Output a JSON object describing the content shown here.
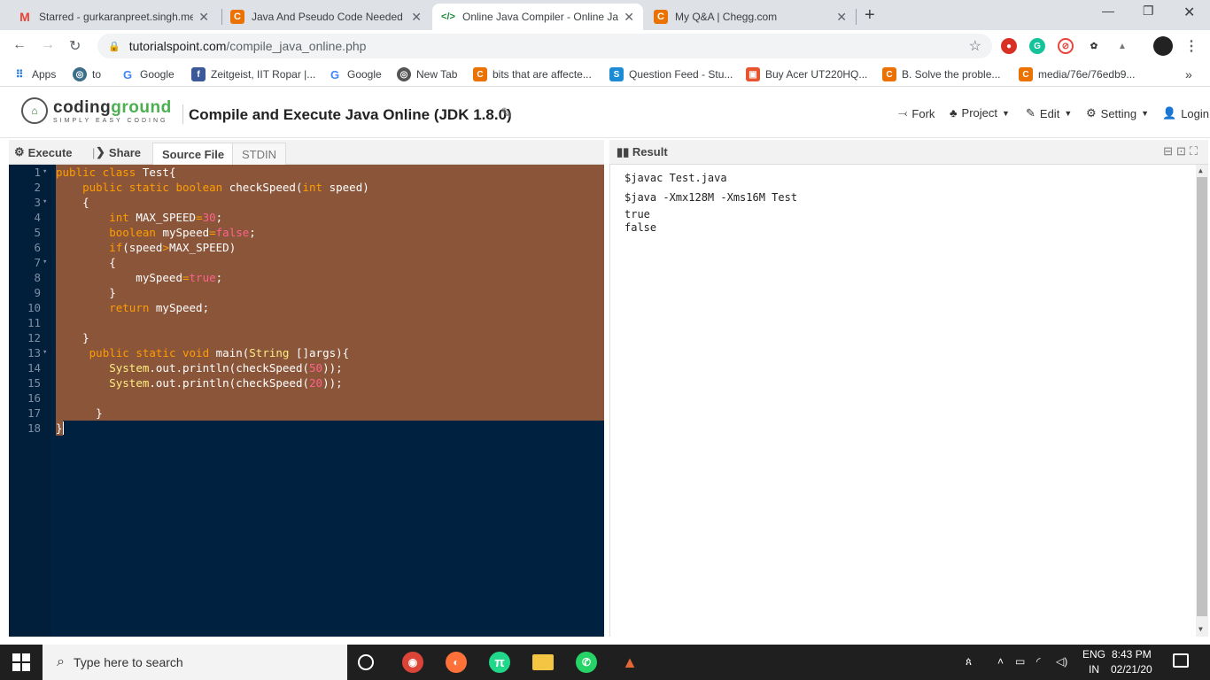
{
  "browser": {
    "tabs": [
      {
        "title": "Starred - gurkaranpreet.singh.me",
        "favicon": "gmail-icon",
        "color": "#ea4335",
        "glyph": "M"
      },
      {
        "title": "Java And Pseudo Code Needed M",
        "favicon": "chegg-icon",
        "color": "#eb7100",
        "glyph": "C"
      },
      {
        "title": "Online Java Compiler - Online Ja",
        "favicon": "code-icon",
        "color": "#1a73e8",
        "glyph": "</>"
      },
      {
        "title": "My Q&A | Chegg.com",
        "favicon": "chegg-icon",
        "color": "#eb7100",
        "glyph": "C"
      }
    ],
    "active_tab": 2,
    "url_domain": "tutorialspoint.com",
    "url_path": "/compile_java_online.php",
    "bookmarks": [
      {
        "label": "Apps",
        "icon": "apps-grid-icon"
      },
      {
        "label": "to",
        "icon": "globe-icon"
      },
      {
        "label": "Google",
        "icon": "google-icon"
      },
      {
        "label": "Zeitgeist, IIT Ropar |...",
        "icon": "facebook-icon"
      },
      {
        "label": "Google",
        "icon": "google-icon"
      },
      {
        "label": "New Tab",
        "icon": "globe-icon"
      },
      {
        "label": "bits that are affecte...",
        "icon": "chegg-icon"
      },
      {
        "label": "Question Feed - Stu...",
        "icon": "chegg-s-icon"
      },
      {
        "label": "Buy Acer UT220HQ...",
        "icon": "shop-icon"
      },
      {
        "label": "B. Solve the proble...",
        "icon": "chegg-icon"
      },
      {
        "label": "media/76e/76edb9...",
        "icon": "chegg-icon"
      }
    ],
    "more_bookmarks": "»"
  },
  "header": {
    "logo_text_a": "coding",
    "logo_text_b": "ground",
    "logo_tagline": "SIMPLY EASY CODING",
    "title": "Compile and Execute Java Online (JDK 1.8.0)",
    "menu": [
      {
        "label": "Fork",
        "icon": "fork-icon"
      },
      {
        "label": "Project",
        "icon": "project-icon",
        "caret": true
      },
      {
        "label": "Edit",
        "icon": "edit-icon",
        "caret": true
      },
      {
        "label": "Setting",
        "icon": "gear-icon",
        "caret": true
      },
      {
        "label": "Login",
        "icon": "user-icon"
      }
    ]
  },
  "toolbar": {
    "execute": "Execute",
    "share": "Share",
    "tabs": [
      "Source File",
      "STDIN"
    ],
    "separator": "|"
  },
  "editor": {
    "lines": [
      [
        [
          "kw",
          "public class "
        ],
        [
          "tx",
          "Test{"
        ]
      ],
      [
        [
          "tx",
          "    "
        ],
        [
          "kw",
          "public static boolean "
        ],
        [
          "tx",
          "checkSpeed("
        ],
        [
          "kw",
          "int"
        ],
        [
          "tx",
          " speed)"
        ]
      ],
      [
        [
          "tx",
          "    {"
        ]
      ],
      [
        [
          "tx",
          ""
        ]
      ],
      [
        [
          "tx",
          "        "
        ],
        [
          "kw",
          "int "
        ],
        [
          "tx",
          "MAX_SPEED"
        ],
        [
          "kw",
          "="
        ],
        [
          "nm",
          "30"
        ],
        [
          "tx",
          ";"
        ]
      ],
      [
        [
          "tx",
          "        "
        ],
        [
          "kw",
          "boolean "
        ],
        [
          "tx",
          "mySpeed"
        ],
        [
          "kw",
          "="
        ],
        [
          "nm",
          "false"
        ],
        [
          "tx",
          ";"
        ]
      ],
      [
        [
          "tx",
          "        "
        ],
        [
          "kw",
          "if"
        ],
        [
          "tx",
          "(speed"
        ],
        [
          "kw",
          ">"
        ],
        [
          "tx",
          "MAX_SPEED)"
        ]
      ],
      [
        [
          "tx",
          "        {"
        ]
      ],
      [
        [
          "tx",
          "            mySpeed"
        ],
        [
          "kw",
          "="
        ],
        [
          "nm",
          "true"
        ],
        [
          "tx",
          ";"
        ]
      ],
      [
        [
          "tx",
          "        }"
        ]
      ],
      [
        [
          "tx",
          "        "
        ],
        [
          "kw",
          "return "
        ],
        [
          "tx",
          "mySpeed;"
        ]
      ],
      [
        [
          "tx",
          ""
        ]
      ],
      [
        [
          "tx",
          "    }"
        ]
      ],
      [
        [
          "tx",
          "     "
        ],
        [
          "kw",
          "public static void "
        ],
        [
          "tx",
          "main("
        ],
        [
          "ty",
          "String "
        ],
        [
          "tx",
          "[]args){"
        ]
      ],
      [
        [
          "tx",
          "        "
        ],
        [
          "ty",
          "System"
        ],
        [
          "tx",
          ".out.println(checkSpeed("
        ],
        [
          "nm",
          "50"
        ],
        [
          "tx",
          "));"
        ]
      ],
      [
        [
          "tx",
          "        "
        ],
        [
          "ty",
          "System"
        ],
        [
          "tx",
          ".out.println(checkSpeed("
        ],
        [
          "nm",
          "20"
        ],
        [
          "tx",
          "));"
        ]
      ],
      [
        [
          "tx",
          ""
        ]
      ],
      [
        [
          "tx",
          "      }"
        ]
      ],
      [
        [
          "tx",
          "}"
        ]
      ]
    ],
    "line_numbers": [
      "1",
      "2",
      "3",
      "",
      "4",
      "5",
      "6",
      "7",
      "8",
      "9",
      "10",
      "11",
      "12",
      "13",
      "14",
      "15",
      "16",
      "17",
      "18"
    ],
    "fold_lines": [
      0,
      2,
      7,
      13
    ]
  },
  "result": {
    "title": "Result",
    "controls": "⊟⊡⛶",
    "output": [
      "$javac Test.java",
      "$java -Xmx128M -Xms16M Test",
      "true",
      "false"
    ]
  },
  "taskbar": {
    "search_placeholder": "Type here to search",
    "lang_top": "ENG",
    "lang_bottom": "IN",
    "time": "8:43 PM",
    "date": "02/21/20",
    "apps": [
      {
        "name": "cortana-icon",
        "color": "#1f1f1f",
        "glyph": "O"
      },
      {
        "name": "chrome-icon",
        "color": "#db4437",
        "glyph": "◉"
      },
      {
        "name": "firefox-icon",
        "color": "#ff7139",
        "glyph": "◐"
      },
      {
        "name": "pycharm-icon",
        "color": "#21d789",
        "glyph": "π"
      },
      {
        "name": "file-explorer-icon",
        "color": "#f4c542",
        "glyph": "▬"
      },
      {
        "name": "whatsapp-icon",
        "color": "#25d366",
        "glyph": "✆"
      },
      {
        "name": "matlab-icon",
        "color": "#e16737",
        "glyph": "▲"
      }
    ]
  }
}
